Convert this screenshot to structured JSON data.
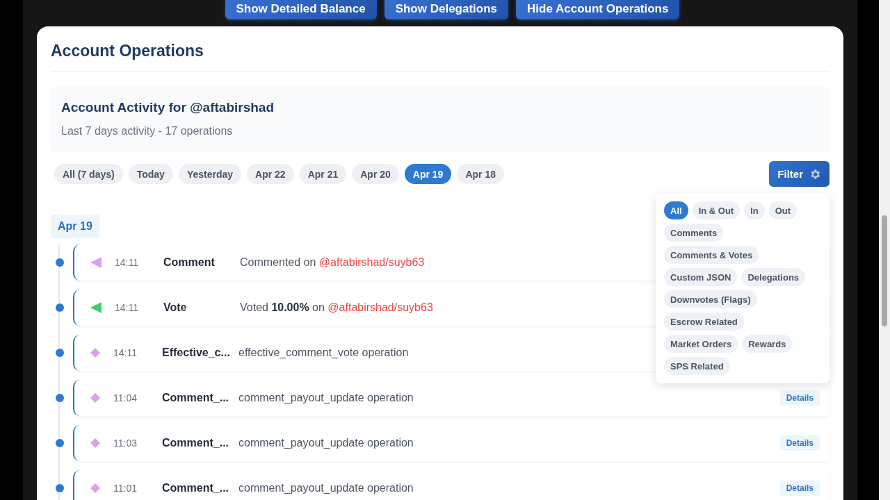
{
  "top_buttons": [
    "Show Detailed Balance",
    "Show Delegations",
    "Hide Account Operations"
  ],
  "panel": {
    "title": "Account Operations",
    "activity": {
      "title": "Account Activity for @aftabirshad",
      "subtitle": "Last 7 days activity - 17 operations"
    },
    "date_chips": [
      {
        "label": "All (7 days)",
        "selected": false
      },
      {
        "label": "Today",
        "selected": false
      },
      {
        "label": "Yesterday",
        "selected": false
      },
      {
        "label": "Apr 22",
        "selected": false
      },
      {
        "label": "Apr 21",
        "selected": false
      },
      {
        "label": "Apr 20",
        "selected": false
      },
      {
        "label": "Apr 19",
        "selected": true
      },
      {
        "label": "Apr 18",
        "selected": false
      }
    ],
    "filter_button": "Filter",
    "filter_menu": [
      {
        "label": "All",
        "selected": true
      },
      {
        "label": "In & Out",
        "selected": false
      },
      {
        "label": "In",
        "selected": false
      },
      {
        "label": "Out",
        "selected": false
      },
      {
        "label": "Comments",
        "selected": false
      },
      {
        "label": "Comments & Votes",
        "selected": false
      },
      {
        "label": "Custom JSON",
        "selected": false
      },
      {
        "label": "Delegations",
        "selected": false
      },
      {
        "label": "Downvotes (Flags)",
        "selected": false
      },
      {
        "label": "Escrow Related",
        "selected": false
      },
      {
        "label": "Market Orders",
        "selected": false
      },
      {
        "label": "Rewards",
        "selected": false
      },
      {
        "label": "SPS Related",
        "selected": false
      }
    ],
    "day_label": "Apr 19",
    "operations": [
      {
        "kind": "triangle",
        "color": "#dda0ee",
        "time": "14:11",
        "type": "Comment",
        "text": "Commented on",
        "link": "@aftabirshad/suyb63"
      },
      {
        "kind": "triangle",
        "color": "#3ecf6e",
        "time": "14:11",
        "type": "Vote",
        "text": "Voted **10.00%** on",
        "link": "@aftabirshad/suyb63"
      },
      {
        "kind": "diamond",
        "color": "#dda0ee",
        "time": "14:11",
        "type": "Effective_c...",
        "text": "effective_comment_vote operation"
      },
      {
        "kind": "diamond",
        "color": "#dda0ee",
        "time": "11:04",
        "type": "Comment_...",
        "text": "comment_payout_update operation",
        "details": "Details"
      },
      {
        "kind": "diamond",
        "color": "#dda0ee",
        "time": "11:03",
        "type": "Comment_...",
        "text": "comment_payout_update operation",
        "details": "Details"
      },
      {
        "kind": "diamond",
        "color": "#dda0ee",
        "time": "11:01",
        "type": "Comment_...",
        "text": "comment_payout_update operation",
        "details": "Details"
      }
    ]
  }
}
